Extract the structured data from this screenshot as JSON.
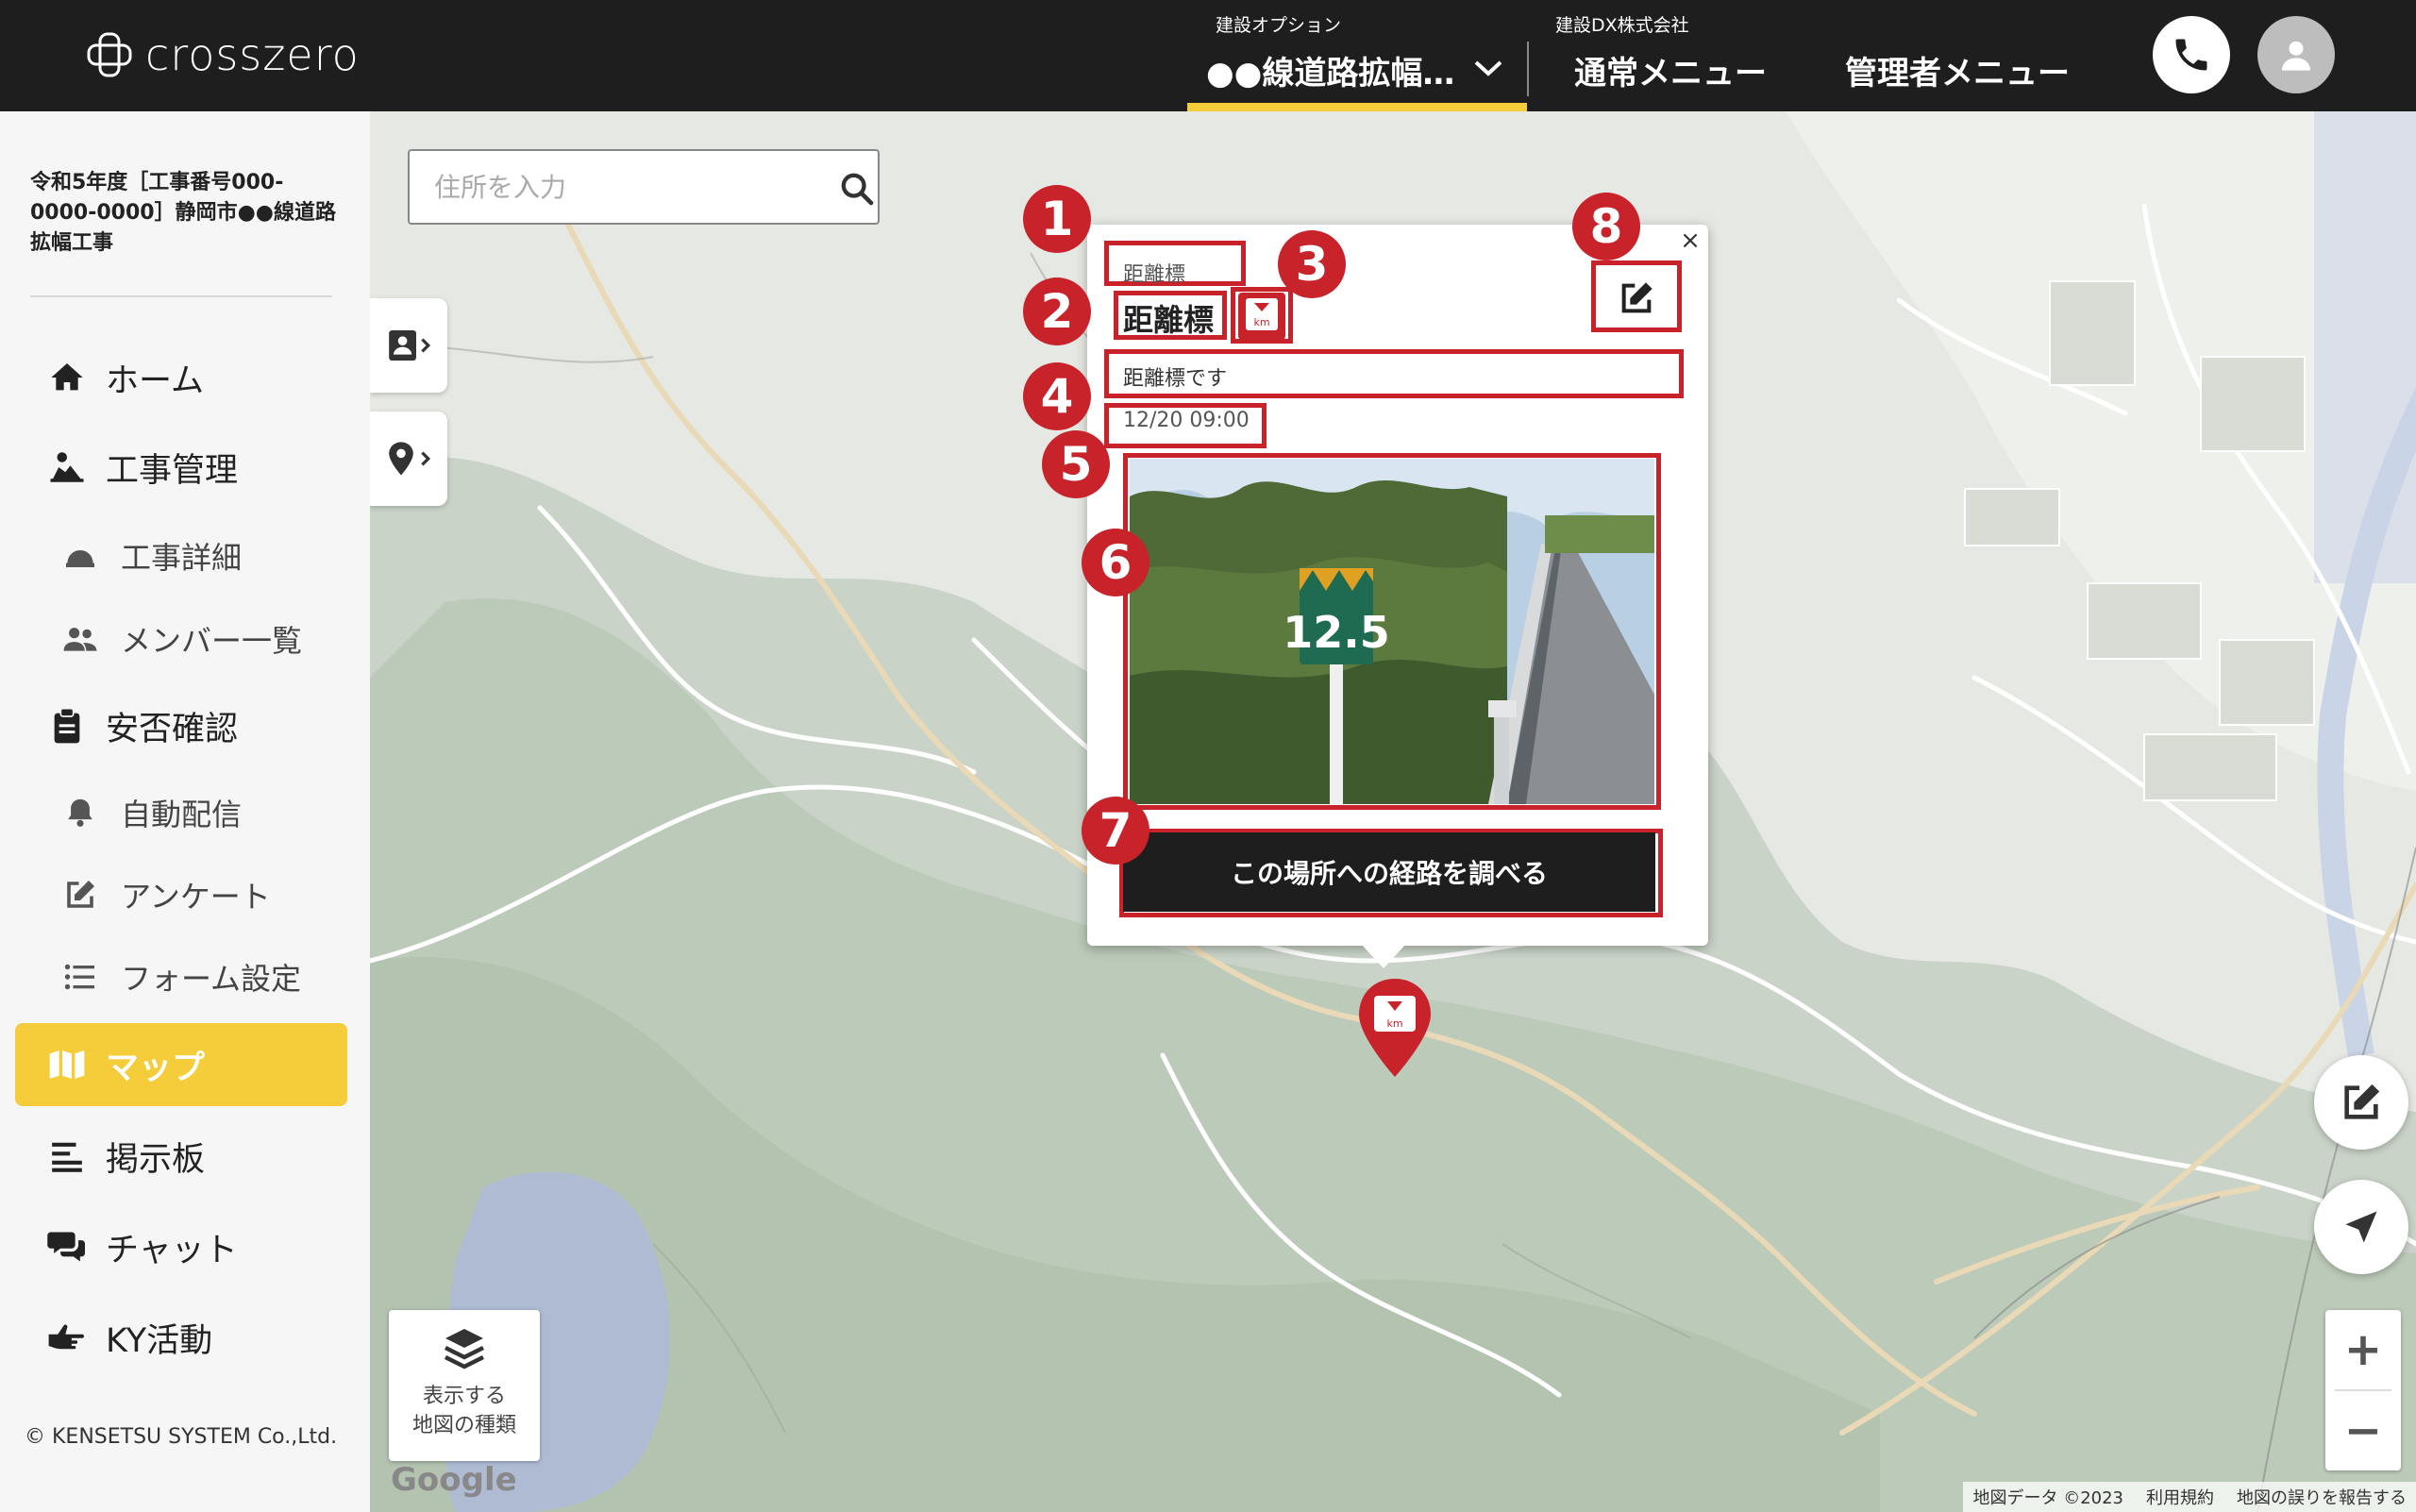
{
  "header": {
    "logo_text": "crosszero",
    "project_caption": "建設オプション",
    "project_name": "●●線道路拡幅…",
    "company_caption": "建設DX株式会社",
    "normal_menu": "通常メニュー",
    "admin_menu": "管理者メニュー"
  },
  "sidebar": {
    "project_title": "令和5年度［工事番号000-0000-0000］静岡市●●線道路拡幅工事",
    "items": [
      {
        "label": "ホーム",
        "icon": "home-icon"
      },
      {
        "label": "工事管理",
        "icon": "construction-worker-icon"
      },
      {
        "label": "工事詳細",
        "icon": "hard-hat-icon"
      },
      {
        "label": "メンバー一覧",
        "icon": "users-icon"
      },
      {
        "label": "安否確認",
        "icon": "clipboard-icon"
      },
      {
        "label": "自動配信",
        "icon": "bell-icon"
      },
      {
        "label": "アンケート",
        "icon": "edit-icon"
      },
      {
        "label": "フォーム設定",
        "icon": "list-icon"
      },
      {
        "label": "マップ",
        "icon": "map-icon"
      },
      {
        "label": "掲示板",
        "icon": "board-icon"
      },
      {
        "label": "チャット",
        "icon": "chat-icon"
      },
      {
        "label": "KY活動",
        "icon": "hand-point-icon"
      }
    ],
    "copyright": "© KENSETSU SYSTEM Co.,Ltd."
  },
  "map": {
    "search_placeholder": "住所を入力",
    "map_type_line1": "表示する",
    "map_type_line2": "地図の種類",
    "google_mark": "Google",
    "attribution": "地図データ ©2023",
    "terms": "利用規約",
    "report": "地図の誤りを報告する",
    "zoom_in": "+",
    "zoom_out": "−"
  },
  "popup": {
    "category": "距離標",
    "title": "距離標",
    "icon_text": "km",
    "description": "距離標です",
    "timestamp": "12/20 09:00",
    "photo_sign_text": "12.5",
    "route_button": "この場所への経路を調べる",
    "close": "×"
  },
  "badges": [
    "1",
    "2",
    "3",
    "4",
    "5",
    "6",
    "7",
    "8"
  ],
  "colors": {
    "header_bg": "#1e1e1e",
    "accent_yellow": "#f5cc3a",
    "annotation_red": "#c8222a"
  }
}
